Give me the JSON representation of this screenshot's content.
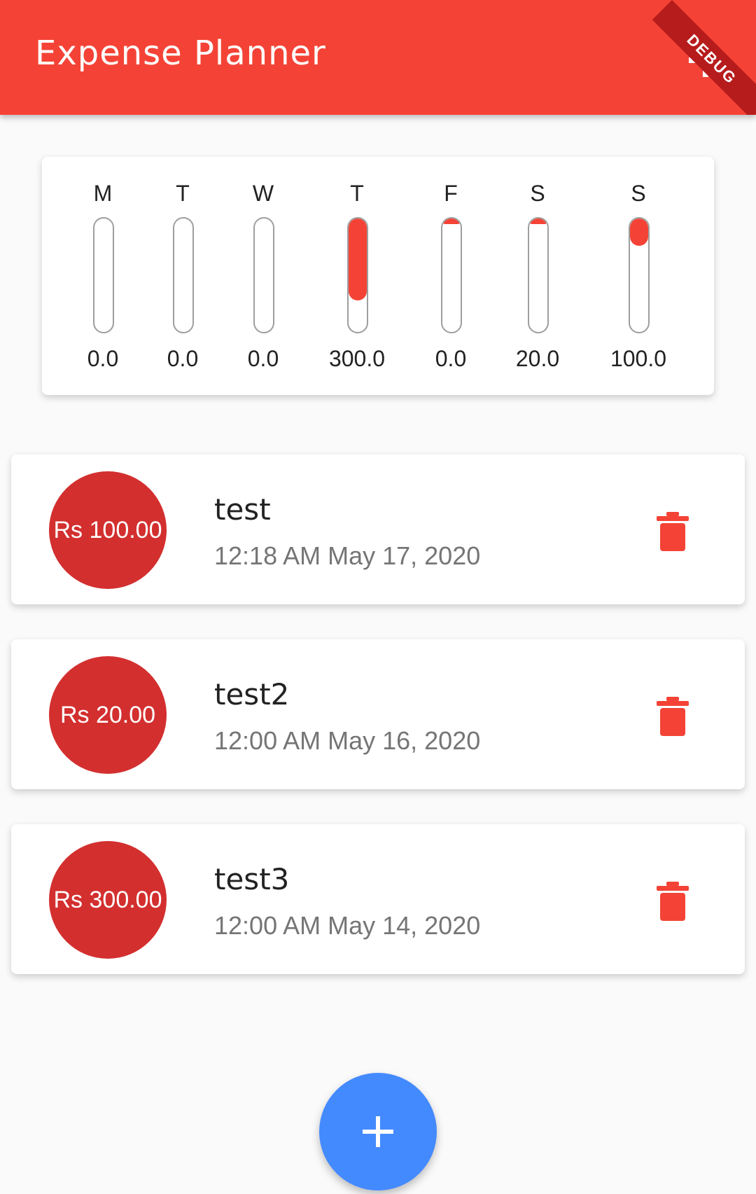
{
  "app": {
    "title": "Expense Planner",
    "debug_banner": "DEBUG"
  },
  "chart_data": {
    "type": "bar",
    "categories": [
      "M",
      "T",
      "W",
      "T",
      "F",
      "S",
      "S"
    ],
    "values": [
      0.0,
      0.0,
      0.0,
      300.0,
      0.0,
      20.0,
      100.0
    ],
    "value_labels": [
      "0.0",
      "0.0",
      "0.0",
      "300.0",
      "0.0",
      "20.0",
      "100.0"
    ],
    "fill_fractions": [
      0,
      0,
      0,
      0.72,
      0.05,
      0.05,
      0.24
    ]
  },
  "transactions": [
    {
      "amount": "Rs 100.00",
      "title": "test",
      "date": "12:18 AM May 17, 2020"
    },
    {
      "amount": "Rs 20.00",
      "title": "test2",
      "date": "12:00 AM May 16, 2020"
    },
    {
      "amount": "Rs 300.00",
      "title": "test3",
      "date": "12:00 AM May 14, 2020"
    }
  ],
  "icons": {
    "add": "add-icon",
    "delete": "trash-icon",
    "fab": "plus-icon"
  },
  "colors": {
    "appbar": "#f44336",
    "avatar": "#d32f2f",
    "bar_fill": "#f44336",
    "fab": "#448aff",
    "delete_icon": "#f44336"
  }
}
